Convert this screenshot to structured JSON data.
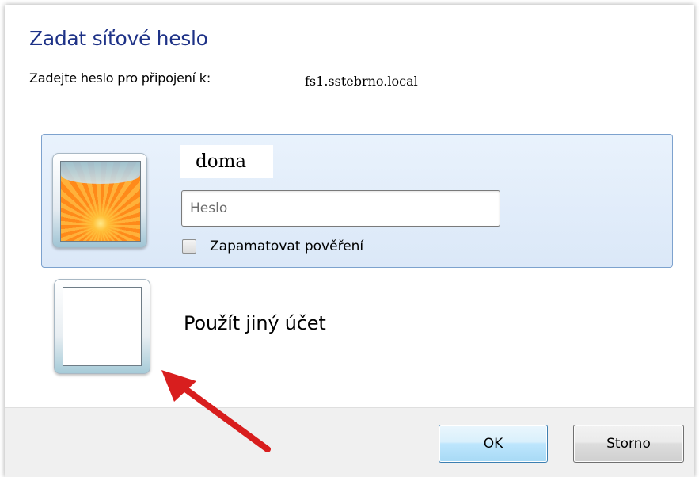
{
  "dialog": {
    "title": "Zadat síťové heslo",
    "prompt": "Zadejte heslo pro připojení k:",
    "server": "fs1.sstebrno.local"
  },
  "selected_account": {
    "username": "doma",
    "password_placeholder": "Heslo",
    "password_value": "",
    "remember_label": "Zapamatovat pověření",
    "remember_checked": false,
    "avatar_icon": "flower-avatar-icon"
  },
  "other_account": {
    "label": "Použít jiný účet",
    "avatar_icon": "blank-avatar-icon"
  },
  "buttons": {
    "ok": "OK",
    "cancel": "Storno"
  },
  "annotation": {
    "arrow_icon": "red-arrow-icon",
    "arrow_color": "#d81e1e"
  },
  "colors": {
    "title": "#1e3287",
    "selection_border": "#7da2ce",
    "selection_fill": "#dbe8f8"
  }
}
